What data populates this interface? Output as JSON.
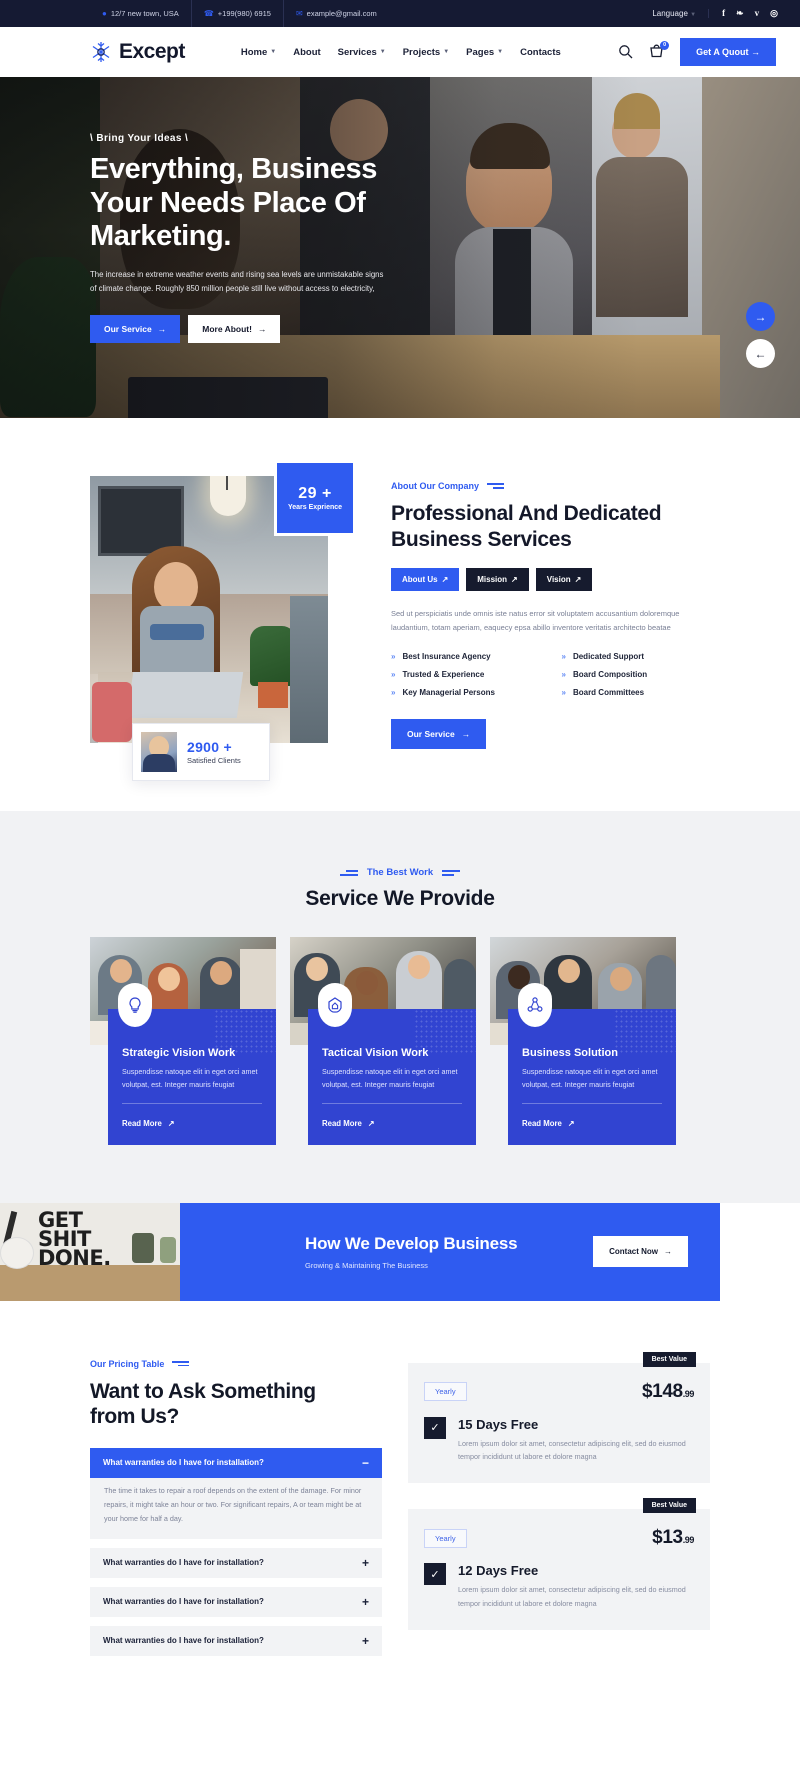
{
  "topbar": {
    "address": "12/7 new town, USA",
    "phone": "+199(980) 6915",
    "email": "example@gmail.com",
    "language": "Language",
    "socials": [
      "f",
      "❧",
      "v",
      "◎"
    ]
  },
  "header": {
    "brand": "Except",
    "nav": [
      {
        "label": "Home",
        "caret": true
      },
      {
        "label": "About",
        "caret": false
      },
      {
        "label": "Services",
        "caret": true
      },
      {
        "label": "Projects",
        "caret": true
      },
      {
        "label": "Pages",
        "caret": true
      },
      {
        "label": "Contacts",
        "caret": false
      }
    ],
    "cart_count": "0",
    "quote_button": "Get A Quout"
  },
  "hero": {
    "kicker": "\\ Bring Your Ideas \\",
    "title_line1": "Everything, Business",
    "title_line2": "Your Needs Place Of",
    "title_line3": "Marketing.",
    "description": "The increase in extreme weather events and rising sea levels are unmistakable signs of climate change. Roughly 850 million people still live without access to electricity,",
    "btn_primary": "Our Service",
    "btn_secondary": "More About!"
  },
  "about": {
    "years_number": "29 +",
    "years_label": "Years Exprience",
    "clients_number": "2900 +",
    "clients_label": "Satisfied Clients",
    "eyebrow": "About Our Company",
    "heading_line1": "Professional And Dedicated",
    "heading_line2": "Business Services",
    "tabs": [
      {
        "label": "About Us",
        "active": true
      },
      {
        "label": "Mission",
        "active": false
      },
      {
        "label": "Vision",
        "active": false
      }
    ],
    "paragraph": "Sed ut perspiciatis unde omnis iste natus error sit voluptatem accusantium doloremque laudantium, totam aperiam, eaquecy epsa abillo inventore veritatis architecto beatae",
    "features": [
      "Best Insurance Agency",
      "Dedicated Support",
      "Trusted & Experience",
      "Board Composition",
      "Key Managerial Persons",
      "Board Committees"
    ],
    "service_button": "Our Service"
  },
  "services": {
    "eyebrow": "The Best Work",
    "title": "Service We Provide",
    "cards": [
      {
        "icon": "lightbulb-icon",
        "title": "Strategic Vision Work",
        "desc": "Suspendisse natoque elit in eget orci amet volutpat, est. Integer mauris feugiat",
        "more": "Read More"
      },
      {
        "icon": "home-shield-icon",
        "title": "Tactical Vision Work",
        "desc": "Suspendisse natoque elit in eget orci amet volutpat, est. Integer mauris feugiat",
        "more": "Read More"
      },
      {
        "icon": "network-icon",
        "title": "Business Solution",
        "desc": "Suspendisse natoque elit in eget orci amet volutpat, est. Integer mauris feugiat",
        "more": "Read More"
      }
    ]
  },
  "cta": {
    "graffiti_line1": "GET",
    "graffiti_line2": "SHIT",
    "graffiti_line3": "DONE.",
    "title": "How We Develop Business",
    "subtitle": "Growing & Maintaining The Business",
    "button": "Contact Now"
  },
  "pricing": {
    "eyebrow": "Our Pricing Table",
    "heading_line1": "Want to Ask Something",
    "heading_line2": "from Us?",
    "faq": [
      {
        "question": "What warranties do I have for installation?",
        "answer": "The time it takes to repair a roof depends on the extent of the damage. For minor repairs, it might take an hour or two. For significant repairs, A or team might be at your home for half a day.",
        "open": true,
        "sign": "−"
      },
      {
        "question": "What warranties do I have for installation?",
        "answer": "",
        "open": false,
        "sign": "+"
      },
      {
        "question": "What warranties do I have for installation?",
        "answer": "",
        "open": false,
        "sign": "+"
      },
      {
        "question": "What warranties do I have for installation?",
        "answer": "",
        "open": false,
        "sign": "+"
      }
    ],
    "plans": [
      {
        "badge": "Best Value",
        "period": "Yearly",
        "price": "$148",
        "cents": ".99",
        "name": "15 Days Free",
        "desc": "Lorem ipsum dolor sit amet, consectetur adipiscing elit, sed do eiusmod tempor incididunt ut labore et dolore magna",
        "checked": true
      },
      {
        "badge": "Best Value",
        "period": "Yearly",
        "price": "$13",
        "cents": ".99",
        "name": "12 Days Free",
        "desc": "Lorem ipsum dolor sit amet, consectetur adipiscing elit, sed do eiusmod tempor incididunt ut labore et dolore magna",
        "checked": true
      }
    ]
  },
  "colors": {
    "accent": "#2f5bf0",
    "dark": "#161b2e",
    "card": "#3144d1",
    "topbar": "#151a33"
  }
}
